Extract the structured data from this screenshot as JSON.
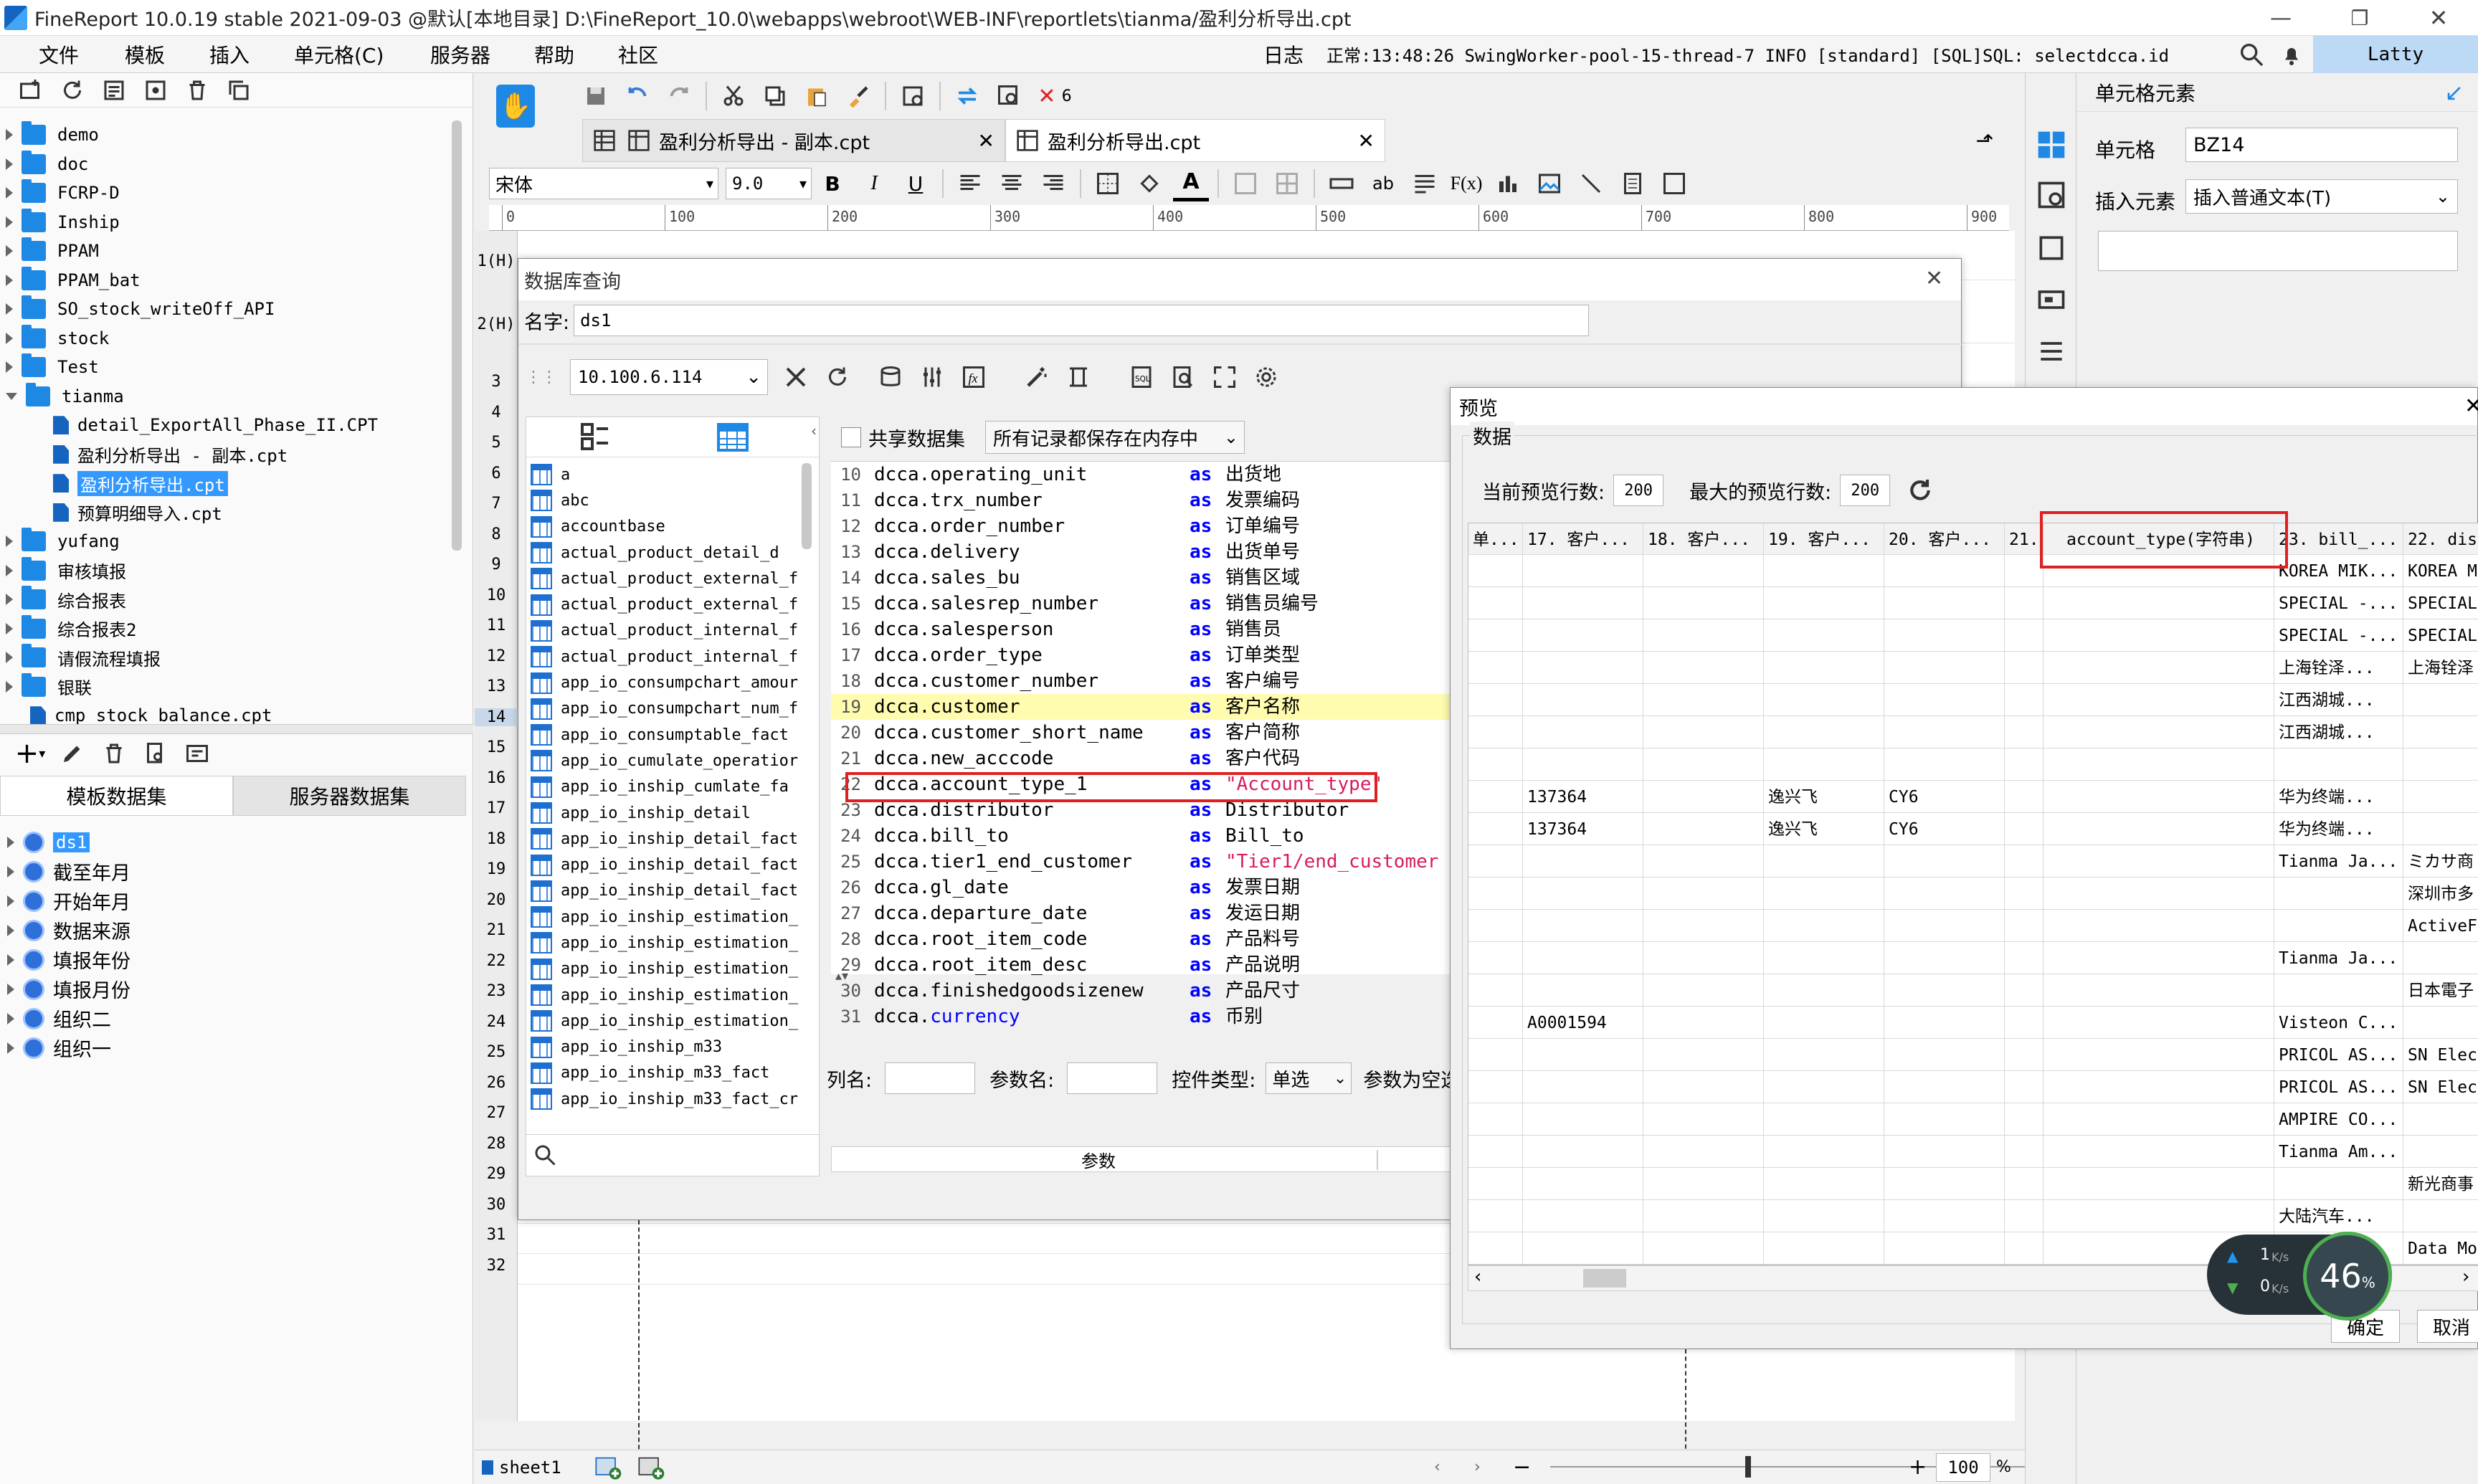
{
  "app": {
    "title": "FineReport 10.0.19 stable 2021-09-03 @默认[本地目录]    D:\\FineReport_10.0\\webapps\\webroot\\WEB-INF\\reportlets\\tianma/盈利分析导出.cpt",
    "user": "Latty"
  },
  "menu": [
    "文件",
    "模板",
    "插入",
    "单元格(C)",
    "服务器",
    "帮助",
    "社区"
  ],
  "log": {
    "label": "日志",
    "text": "正常:13:48:26 SwingWorker-pool-15-thread-7 INFO [standard] [SQL]SQL: selectdcca.id"
  },
  "tree": [
    {
      "label": "demo",
      "type": "folder",
      "indent": 0
    },
    {
      "label": "doc",
      "type": "folder",
      "indent": 0
    },
    {
      "label": "FCRP-D",
      "type": "folder",
      "indent": 0
    },
    {
      "label": "Inship",
      "type": "folder",
      "indent": 0
    },
    {
      "label": "PPAM",
      "type": "folder",
      "indent": 0
    },
    {
      "label": "PPAM_bat",
      "type": "folder",
      "indent": 0
    },
    {
      "label": "SO_stock_writeOff_API",
      "type": "folder",
      "indent": 0
    },
    {
      "label": "stock",
      "type": "folder",
      "indent": 0
    },
    {
      "label": "Test",
      "type": "folder",
      "indent": 0
    },
    {
      "label": "tianma",
      "type": "folder-open",
      "indent": 0
    },
    {
      "label": "detail_ExportAll_Phase_II.CPT",
      "type": "file",
      "indent": 1
    },
    {
      "label": "盈利分析导出 - 副本.cpt",
      "type": "file",
      "indent": 1
    },
    {
      "label": "盈利分析导出.cpt",
      "type": "file",
      "indent": 1,
      "selected": true
    },
    {
      "label": "预算明细导入.cpt",
      "type": "file",
      "indent": 1
    },
    {
      "label": "yufang",
      "type": "folder",
      "indent": 0
    },
    {
      "label": "审核填报",
      "type": "folder",
      "indent": 0
    },
    {
      "label": "综合报表",
      "type": "folder",
      "indent": 0
    },
    {
      "label": "综合报表2",
      "type": "folder",
      "indent": 0
    },
    {
      "label": "请假流程填报",
      "type": "folder",
      "indent": 0
    },
    {
      "label": "银联",
      "type": "folder",
      "indent": 0
    },
    {
      "label": "cmp_stock_balance.cpt",
      "type": "file",
      "indent": 0
    }
  ],
  "dataset_tabs": [
    "模板数据集",
    "服务器数据集"
  ],
  "datasets": [
    "ds1",
    "截至年月",
    "开始年月",
    "数据来源",
    "填报年份",
    "填报月份",
    "组织二",
    "组织一"
  ],
  "tabs": [
    {
      "label": "盈利分析导出 - 副本.cpt"
    },
    {
      "label": "盈利分析导出.cpt"
    }
  ],
  "format": {
    "font": "宋体",
    "size": "9.0"
  },
  "ruler": [
    "0",
    "100",
    "200",
    "300",
    "400",
    "500",
    "600",
    "700",
    "800",
    "900"
  ],
  "row_numbers": [
    "1(H)",
    "2(H)",
    "3",
    "4",
    "5",
    "6",
    "7",
    "8",
    "9",
    "10",
    "11",
    "12",
    "13",
    "14",
    "15",
    "16",
    "17",
    "18",
    "19",
    "20",
    "21",
    "22",
    "23",
    "24",
    "25",
    "26",
    "27",
    "28",
    "29",
    "30",
    "31",
    "32"
  ],
  "sheet": {
    "name": "sheet1",
    "zoom": "100",
    "zoom_unit": "%"
  },
  "db_dialog": {
    "title": "数据库查询",
    "name_label": "名字:",
    "name_value": "ds1",
    "connection": "10.100.6.114",
    "share_label": "共享数据集",
    "cache_option": "所有记录都保存在内存中",
    "tables": [
      "a",
      "abc",
      "accountbase",
      "actual_product_detail_d",
      "actual_product_external_f",
      "actual_product_external_f",
      "actual_product_internal_f",
      "actual_product_internal_f",
      "app_io_consumpchart_amour",
      "app_io_consumpchart_num_f",
      "app_io_consumptable_fact",
      "app_io_cumulate_operatior",
      "app_io_inship_cumlate_fa",
      "app_io_inship_detail",
      "app_io_inship_detail_fact",
      "app_io_inship_detail_fact",
      "app_io_inship_detail_fact",
      "app_io_inship_estimation_",
      "app_io_inship_estimation_",
      "app_io_inship_estimation_",
      "app_io_inship_estimation_",
      "app_io_inship_estimation_",
      "app_io_inship_m33",
      "app_io_inship_m33_fact",
      "app_io_inship_m33_fact_cr"
    ],
    "sql_lines": [
      {
        "n": "10",
        "expr": "dcca.operating_unit",
        "as": "as",
        "alias": "出货地"
      },
      {
        "n": "11",
        "expr": "dcca.trx_number",
        "as": "as",
        "alias": "发票编码"
      },
      {
        "n": "12",
        "expr": "dcca.order_number",
        "as": "as",
        "alias": "订单编号"
      },
      {
        "n": "13",
        "expr": "dcca.delivery",
        "as": "as",
        "alias": "出货单号"
      },
      {
        "n": "14",
        "expr": "dcca.sales_bu",
        "as": "as",
        "alias": "销售区域"
      },
      {
        "n": "15",
        "expr": "dcca.salesrep_number",
        "as": "as",
        "alias": "销售员编号"
      },
      {
        "n": "16",
        "expr": "dcca.salesperson",
        "as": "as",
        "alias": "销售员"
      },
      {
        "n": "17",
        "expr": "dcca.order_type",
        "as": "as",
        "alias": "订单类型"
      },
      {
        "n": "18",
        "expr": "dcca.customer_number",
        "as": "as",
        "alias": "客户编号"
      },
      {
        "n": "19",
        "expr": "dcca.customer",
        "as": "as",
        "alias": "客户名称",
        "hl": true
      },
      {
        "n": "20",
        "expr": "dcca.customer_short_name",
        "as": "as",
        "alias": "客户简称"
      },
      {
        "n": "21",
        "expr": "dcca.new_acccode",
        "as": "as",
        "alias": "客户代码"
      },
      {
        "n": "22",
        "expr": "dcca.account_type_1",
        "as": "as",
        "alias": "\"Account_type\"",
        "str": true
      },
      {
        "n": "23",
        "expr": "dcca.distributor",
        "as": "as",
        "alias": "Distributor"
      },
      {
        "n": "24",
        "expr": "dcca.bill_to",
        "as": "as",
        "alias": "Bill_to"
      },
      {
        "n": "25",
        "expr": "dcca.tier1_end_customer",
        "as": "as",
        "alias": "\"Tier1/end_customer",
        "str": true
      },
      {
        "n": "26",
        "expr": "dcca.gl_date",
        "as": "as",
        "alias": "发票日期"
      },
      {
        "n": "27",
        "expr": "dcca.departure_date",
        "as": "as",
        "alias": "发运日期"
      },
      {
        "n": "28",
        "expr": "dcca.root_item_code",
        "as": "as",
        "alias": "产品料号"
      },
      {
        "n": "29",
        "expr": "dcca.root_item_desc",
        "as": "as",
        "alias": "产品说明"
      },
      {
        "n": "30",
        "expr": "dcca.finishedgoodsizenew",
        "as": "as",
        "alias": "产品尺寸"
      },
      {
        "n": "31",
        "expr": "dcca.currency",
        "as": "as",
        "alias": "币别",
        "kw": true
      }
    ],
    "param_labels": {
      "col": "列名:",
      "param": "参数名:",
      "ctrl": "控件类型:",
      "ctrl_value": "单选",
      "empty": "参数为空选",
      "params_header": "参数"
    }
  },
  "preview": {
    "title": "预览",
    "section": "数据",
    "cur_rows_label": "当前预览行数:",
    "cur_rows": "200",
    "max_rows_label": "最大的预览行数:",
    "max_rows": "200",
    "columns": [
      "单...",
      "17. 客户...",
      "18. 客户...",
      "19. 客户...",
      "20. 客户...",
      "21.",
      "account_type(字符串)",
      "23. bill_...",
      "22. dis"
    ],
    "rows": [
      [
        "",
        "",
        "",
        "",
        "",
        "",
        "",
        "KOREA MIK...",
        "KOREA M"
      ],
      [
        "",
        "",
        "",
        "",
        "",
        "",
        "",
        "SPECIAL -...",
        "SPECIAL"
      ],
      [
        "",
        "",
        "",
        "",
        "",
        "",
        "",
        "SPECIAL -...",
        "SPECIAL"
      ],
      [
        "",
        "",
        "",
        "",
        "",
        "",
        "",
        "上海铨泽...",
        "上海铨泽"
      ],
      [
        "",
        "",
        "",
        "",
        "",
        "",
        "",
        "江西湖城...",
        ""
      ],
      [
        "",
        "",
        "",
        "",
        "",
        "",
        "",
        "江西湖城...",
        ""
      ],
      [
        "",
        "",
        "",
        "",
        "",
        "",
        "",
        "",
        ""
      ],
      [
        "",
        "137364",
        "",
        "逸兴飞",
        "CY6",
        "",
        "",
        "华为终端...",
        ""
      ],
      [
        "",
        "137364",
        "",
        "逸兴飞",
        "CY6",
        "",
        "",
        "华为终端...",
        ""
      ],
      [
        "",
        "",
        "",
        "",
        "",
        "",
        "",
        "Tianma Ja...",
        "ミカサ商"
      ],
      [
        "",
        "",
        "",
        "",
        "",
        "",
        "",
        "",
        "深圳市多"
      ],
      [
        "",
        "",
        "",
        "",
        "",
        "",
        "",
        "",
        "ActiveF"
      ],
      [
        "",
        "",
        "",
        "",
        "",
        "",
        "",
        "Tianma Ja...",
        ""
      ],
      [
        "",
        "",
        "",
        "",
        "",
        "",
        "",
        "",
        "日本電子"
      ],
      [
        "",
        "A0001594",
        "",
        "",
        "",
        "",
        "",
        "Visteon C...",
        ""
      ],
      [
        "",
        "",
        "",
        "",
        "",
        "",
        "",
        "PRICOL AS...",
        "SN Elec"
      ],
      [
        "",
        "",
        "",
        "",
        "",
        "",
        "",
        "PRICOL AS...",
        "SN Elec"
      ],
      [
        "",
        "",
        "",
        "",
        "",
        "",
        "",
        "AMPIRE CO...",
        ""
      ],
      [
        "",
        "",
        "",
        "",
        "",
        "",
        "",
        "Tianma Am...",
        ""
      ],
      [
        "",
        "",
        "",
        "",
        "",
        "",
        "",
        "",
        "新光商事"
      ],
      [
        "",
        "",
        "",
        "",
        "",
        "",
        "",
        "大陆汽车...",
        ""
      ],
      [
        "",
        "",
        "",
        "",
        "",
        "",
        "",
        "",
        "Data Mo"
      ]
    ],
    "ok": "确定",
    "cancel": "取消"
  },
  "net": {
    "up": "1",
    "up_unit": "K/s",
    "down": "0",
    "down_unit": "K/s",
    "pct": "46",
    "pct_unit": "%"
  },
  "right_panel": {
    "title": "单元格元素",
    "cell_label": "单元格",
    "cell_value": "BZ14",
    "insert_label": "插入元素",
    "insert_value": "插入普通文本(T)"
  },
  "colors": {
    "accent": "#1e88e5",
    "highlight": "#fffcb0",
    "red": "#e02020",
    "selected": "#3399ff"
  }
}
